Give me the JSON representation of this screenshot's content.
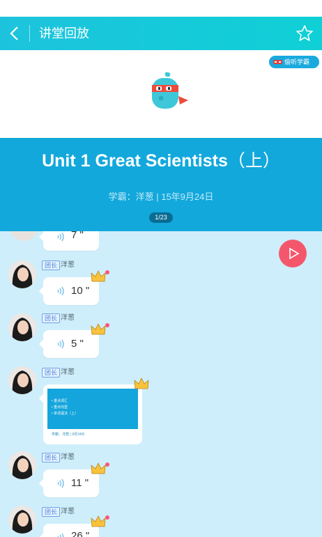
{
  "header": {
    "title": "讲堂回放"
  },
  "banner": {
    "badge": "偷听学霸"
  },
  "course": {
    "title": "Unit 1 Great Scientists",
    "title_suffix": "（上）",
    "subtitle": "学霸：洋葱 | 15年9月24日",
    "pager": "1/23"
  },
  "messages": [
    {
      "duration": "7 \""
    },
    {
      "tag": "团长",
      "name": "洋葱",
      "duration": "10 \""
    },
    {
      "tag": "团长",
      "name": "洋葱",
      "duration": "5 \""
    },
    {
      "tag": "团长",
      "name": "洋葱",
      "image": {
        "lines": [
          "• 重点词汇",
          "• 重点句型",
          "• 单词语法（上）"
        ],
        "footer": "学霸：洋葱 | 9月24日"
      }
    },
    {
      "tag": "团长",
      "name": "洋葱",
      "duration": "11 \""
    },
    {
      "tag": "团长",
      "name": "洋葱",
      "duration": "26 \""
    }
  ],
  "colors": {
    "header": "#1dc3dd",
    "course_bg": "#12a8dc",
    "chat_bg": "#cfeefb",
    "play": "#f4576c"
  }
}
